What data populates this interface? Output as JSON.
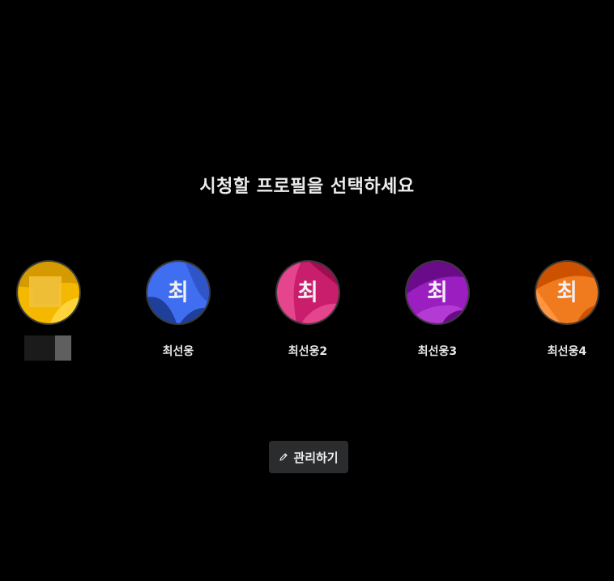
{
  "page": {
    "title": "시청할 프로필을 선택하세요"
  },
  "profiles": [
    {
      "initial": "",
      "name": "",
      "colors": {
        "base": "#f5b800",
        "accent": "#d49a00",
        "light": "#ffd43a"
      }
    },
    {
      "initial": "최",
      "name": "최선웅",
      "colors": {
        "base": "#3f6ff0",
        "accent": "#1e3f9a",
        "light": "#5c88ff"
      }
    },
    {
      "initial": "최",
      "name": "최선웅2",
      "colors": {
        "base": "#c81e6c",
        "accent": "#9e0f52",
        "light": "#e4458c"
      }
    },
    {
      "initial": "최",
      "name": "최선웅3",
      "colors": {
        "base": "#9b1ec0",
        "accent": "#6a0c8a",
        "light": "#b43ad4"
      }
    },
    {
      "initial": "최",
      "name": "최선웅4",
      "colors": {
        "base": "#f07a1e",
        "accent": "#cc5200",
        "light": "#ff9540"
      }
    }
  ],
  "actions": {
    "manage_label": "관리하기",
    "manage_icon": "pencil-icon"
  }
}
